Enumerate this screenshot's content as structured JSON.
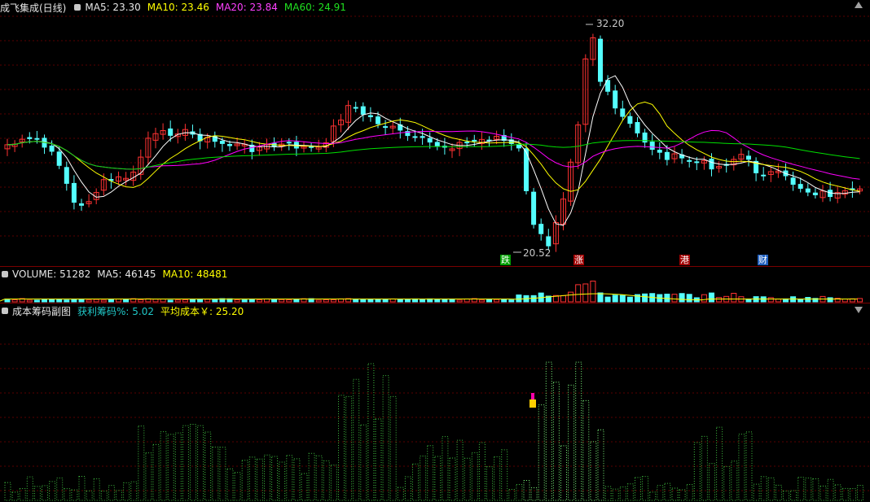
{
  "kline": {
    "title": "成飞集成(日线)",
    "ma5": "MA5: 23.30",
    "ma10": "MA10: 23.46",
    "ma20": "MA20: 23.84",
    "ma60": "MA60: 24.91",
    "high_label": "32.20",
    "low_label": "20.52",
    "tags": [
      "跌",
      "涨",
      "港",
      "财"
    ],
    "colors": {
      "ma5": "#ffffff",
      "ma10": "#ffff00",
      "ma20": "#ff00ff",
      "ma60": "#00e000",
      "up": "#ff3232",
      "down": "#54ffff"
    }
  },
  "volume": {
    "label": "VOLUME: 51282",
    "ma5": "MA5: 46145",
    "ma10": "MA10: 48481"
  },
  "chips": {
    "title": "成本筹码副图",
    "profit": "获利筹码%: 5.02",
    "avg_cost": "平均成本￥: 25.20"
  },
  "icons": {
    "collapse": "triangle-up-icon",
    "expand": "triangle-down-icon"
  }
}
